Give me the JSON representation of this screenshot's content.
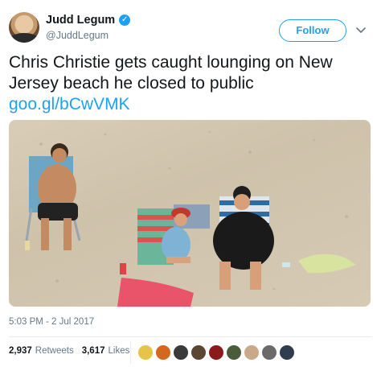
{
  "author": {
    "display_name": "Judd Legum",
    "handle": "@JuddLegum",
    "verified_glyph": "✓"
  },
  "follow_button": {
    "label": "Follow"
  },
  "tweet": {
    "text": "Chris Christie gets caught lounging on New Jersey beach he closed to public",
    "link": "goo.gl/bCwVMK",
    "timestamp": "5:03 PM - 2 Jul 2017"
  },
  "stats": {
    "retweets_count": "2,937",
    "retweets_label": "Retweets",
    "likes_count": "3,617",
    "likes_label": "Likes"
  },
  "liker_avatar_colors": [
    "#e8c34a",
    "#d2691e",
    "#3a3a3a",
    "#5a4632",
    "#8b1a1a",
    "#4a5d3a",
    "#c9a98a",
    "#6a6a6a",
    "#2f3e4e"
  ],
  "colors": {
    "accent": "#1da1f2",
    "text": "#14171a",
    "muted": "#657786"
  }
}
